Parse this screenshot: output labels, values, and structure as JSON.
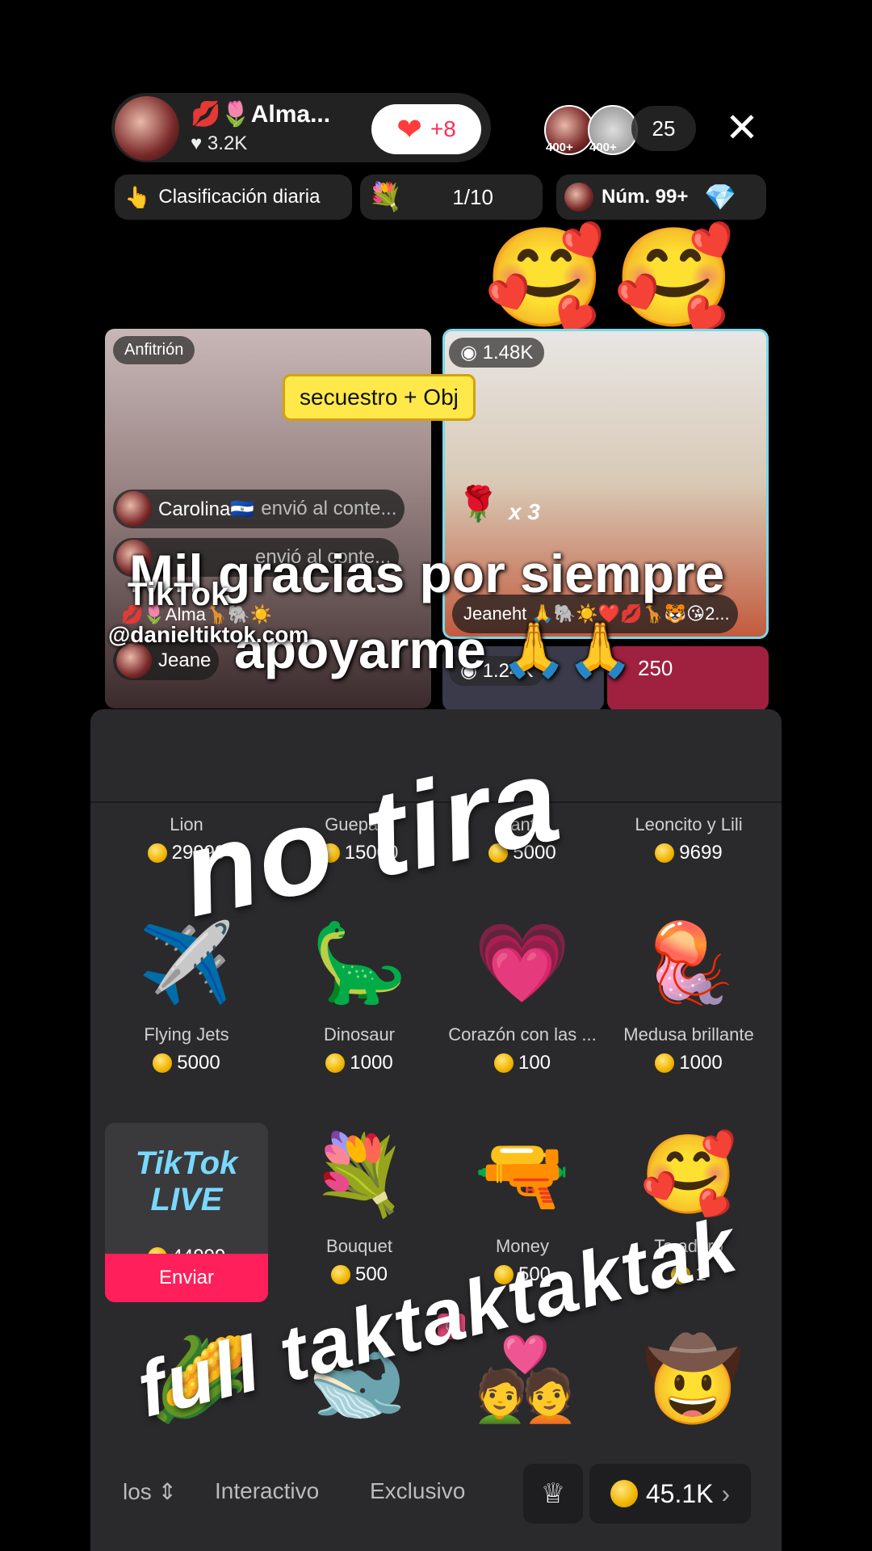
{
  "header": {
    "host_name": "💋🌷Alma...",
    "host_likes": "3.2K",
    "like_count": "+8",
    "viewer_badges": [
      "400+",
      "400+"
    ],
    "viewer_count": "25"
  },
  "chips": {
    "ranking": "Clasificación diaria",
    "progress": "1/10",
    "rank_num": "Núm. 99+"
  },
  "stream": {
    "host_tag": "Anfitrión",
    "guest_views": "1.48K",
    "sticker": "secuestro + Obj",
    "comment1_user": "Carolina🇸🇻",
    "comment1_text": "envió al conte...",
    "comment2_text": "envió al conte...",
    "guest_name": "Jeaneht 🙏🐘☀️❤️💋🦒🐯😘2...",
    "rose_count": "x 3",
    "tile3_views": "1.24K",
    "tile4_views": "250",
    "comment_jeane": "Jeane",
    "alma_line": "💋🌷Alma🦒🐘☀️"
  },
  "overlay": {
    "line1": "Mil gracias por siempre",
    "line2": "apoyarme 🙏🙏",
    "watermark1": "TikTok",
    "watermark2": "@danieltiktok.com",
    "big1": "no tira",
    "big2": "full taktaktaktak"
  },
  "gifts_row0": [
    {
      "name": "Lion",
      "price": "29999"
    },
    {
      "name": "Guepard",
      "price": "15000"
    },
    {
      "name": "Fanta",
      "price": "5000"
    },
    {
      "name": "Leoncito y Lili",
      "price": "9699"
    }
  ],
  "gifts_row1": [
    {
      "name": "Flying Jets",
      "price": "5000",
      "icon": "jet-icon"
    },
    {
      "name": "Dinosaur",
      "price": "1000",
      "icon": "dinosaur-icon"
    },
    {
      "name": "Corazón con las ...",
      "price": "100",
      "icon": "heart-icon"
    },
    {
      "name": "Medusa brillante",
      "price": "1000",
      "icon": "jellyfish-icon"
    }
  ],
  "gifts_row2": [
    {
      "name": "",
      "price": "44999",
      "icon": "tiktok-live-icon"
    },
    {
      "name": "Bouquet",
      "price": "500",
      "icon": "bouquet-icon"
    },
    {
      "name": "Money",
      "price": "500",
      "icon": "money-gun-icon"
    },
    {
      "name": "Te adoro",
      "price": "1",
      "icon": "love-emoji-icon"
    }
  ],
  "send_label": "Enviar",
  "tabs": {
    "tab0": "los",
    "tab1": "Interactivo",
    "tab2": "Exclusivo"
  },
  "balance": "45.1K"
}
